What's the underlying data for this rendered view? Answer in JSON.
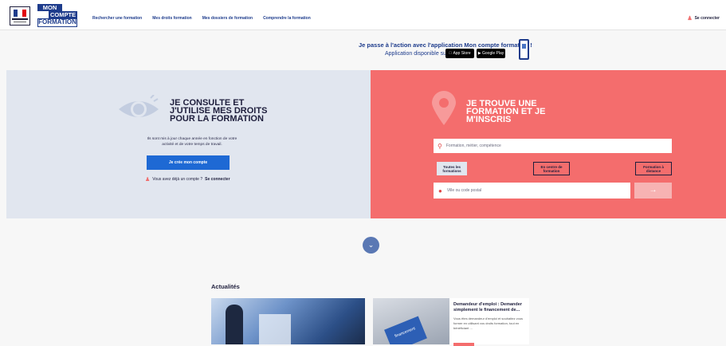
{
  "header": {
    "logo": {
      "line1": "MON",
      "line2": "COMPTE",
      "line3": "FORMATION"
    },
    "nav": [
      "Rechercher une formation",
      "Mes droits formation",
      "Mes dossiers de formation",
      "Comprendre la formation"
    ],
    "login": "Se connecter"
  },
  "app_banner": {
    "line1": "Je passe à l'action avec l'application Mon compte formation !",
    "line2": "Application disponible sur",
    "app_store": "App Store",
    "google_play": "Google Play"
  },
  "left": {
    "headline": "JE CONSULTE ET J'UTILISE MES DROITS POUR LA FORMATION",
    "info": "Ils sont mis à jour chaque année en fonction de votre activité et de votre temps de travail.",
    "create_button": "Je crée mon compte",
    "already_text": "Vous avez déjà un compte ?",
    "already_link": "Se connecter"
  },
  "right": {
    "headline": "JE TROUVE UNE FORMATION ET JE M'INSCRIS",
    "search_placeholder": "Formation, métier, compétence",
    "filters": [
      "Toutes les formations",
      "En centre de formation",
      "Formation à distance"
    ],
    "city_placeholder": "Ville ou code postal"
  },
  "news": {
    "title": "Actualités",
    "card_title": "Demandeur d'emploi : Demander simplement le financement de...",
    "card_text": "Vous êtes demandeur d'emploi et souhaitez vous former en utilisant vos droits formation, tout en bénéficiant ...",
    "img2_label": "financement"
  },
  "colors": {
    "brand_blue": "#1e3c8c",
    "coral": "#f46d6d",
    "light_blue": "#e1e6ef",
    "cta_blue": "#1e69d4"
  }
}
